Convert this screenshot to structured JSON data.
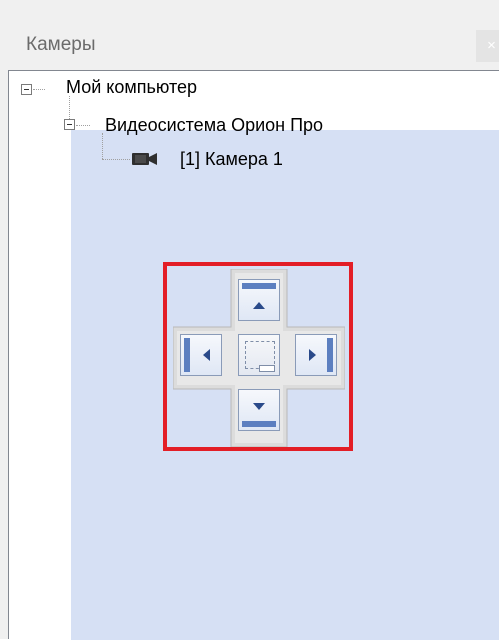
{
  "panel": {
    "title": "Камеры",
    "close_label": "×"
  },
  "tree": {
    "nodes": [
      {
        "label": "Мой компьютер",
        "expander": "−"
      },
      {
        "label": "Видеосистема Орион Про",
        "expander": "−"
      },
      {
        "label": "[1] Камера 1",
        "icon": "camera-icon"
      }
    ]
  },
  "dock_guide": {
    "buttons": [
      "dock-top-icon",
      "dock-left-icon",
      "dock-center-icon",
      "dock-right-icon",
      "dock-bottom-icon"
    ],
    "highlight_color": "#e31e26",
    "preview_color": "#d6e0f4"
  }
}
